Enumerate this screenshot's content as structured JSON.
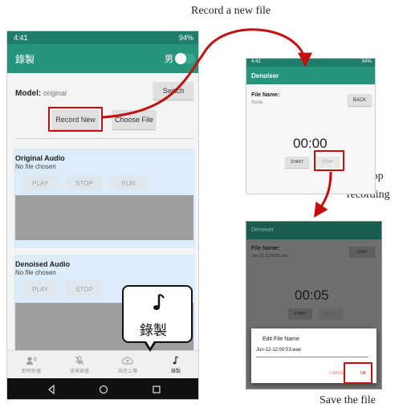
{
  "annotations": {
    "record_new": "Record a new file",
    "stop": "Stop",
    "recording": "recording",
    "save": "Save the file"
  },
  "phone1": {
    "status_time": "4:41",
    "status_battery": "94%",
    "app_title": "錄製",
    "gender_label": "男",
    "model_label": "Model:",
    "model_value": "original",
    "switch_button": "Switch",
    "record_new_button": "Record New",
    "choose_file_button": "Choose File",
    "original_audio": {
      "title": "Original Audio",
      "status": "No file chosen",
      "play": "PLAY",
      "stop": "STOP",
      "run": "RUN"
    },
    "denoised_audio": {
      "title": "Denoised Audio",
      "status": "No file chosen",
      "play": "PLAY",
      "stop": "STOP"
    },
    "bubble_label": "錄製",
    "nav": [
      {
        "label": "即時即播",
        "icon": "person-audio-icon"
      },
      {
        "label": "背景錄播",
        "icon": "mic-off-icon"
      },
      {
        "label": "語音上傳",
        "icon": "cloud-upload-icon"
      },
      {
        "label": "錄製",
        "icon": "music-note-icon"
      }
    ]
  },
  "phone2": {
    "status_time": "4:42",
    "status_battery": "94%",
    "app_title": "Denoiser",
    "file_name_label": "File Name:",
    "file_name_value": "None",
    "back_button": "BACK",
    "timer": "00:00",
    "start_button": "START",
    "stop_button": "STOP"
  },
  "phone3": {
    "app_title": "Denoiser",
    "file_name_label": "File Name:",
    "file_name_value": "Jun-12-12:00:53.wav",
    "save_button": "SAVE",
    "timer": "00:05",
    "start_button": "START",
    "stop_button": "STOP",
    "dialog": {
      "title": "Edit File Name",
      "input_value": "Jun-12-12:00:53.wav",
      "cancel": "CANCEL",
      "ok": "OK"
    }
  },
  "colors": {
    "app_bar": "#26957d",
    "status_bar": "#1e7e6b",
    "highlight": "#c40f10",
    "card": "#dcecfb"
  }
}
